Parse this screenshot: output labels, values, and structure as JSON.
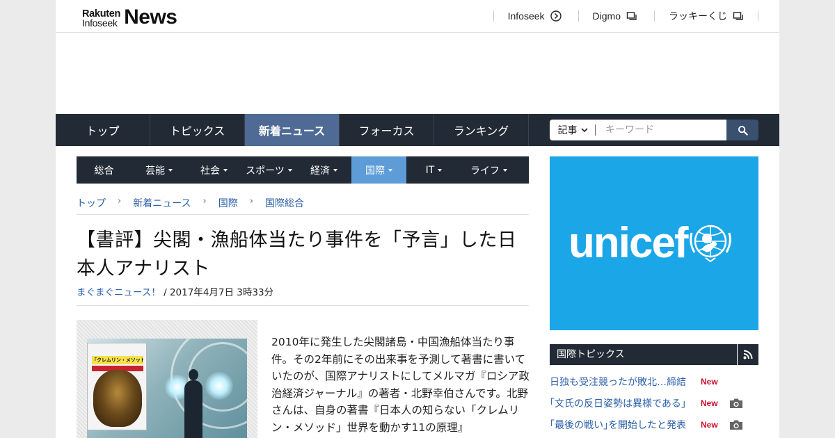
{
  "header": {
    "logo_top": "Rakuten",
    "logo_bottom": "Infoseek",
    "logo_main": "News",
    "links": [
      {
        "label": "Infoseek",
        "icon": "arrow-circle-icon"
      },
      {
        "label": "Digmo",
        "icon": "external-window-icon"
      },
      {
        "label": "ラッキーくじ",
        "icon": "external-window-icon"
      }
    ]
  },
  "main_nav": {
    "items": [
      "トップ",
      "トピックス",
      "新着ニュース",
      "フォーカス",
      "ランキング"
    ],
    "active": "新着ニュース"
  },
  "search": {
    "category": "記事",
    "placeholder": "キーワード"
  },
  "sub_nav": {
    "items": [
      "総合",
      "芸能",
      "社会",
      "スポーツ",
      "経済",
      "国際",
      "IT",
      "ライフ"
    ],
    "active": "国際"
  },
  "breadcrumb": [
    "トップ",
    "新着ニュース",
    "国際",
    "国際総合"
  ],
  "article": {
    "title": "【書評】尖閣・漁船体当たり事件を「予言」した日本人アナリスト",
    "source": "まぐまぐニュース！",
    "date": "/ 2017年4月7日 3時33分",
    "book_title": "「クレムリン・メソッド」",
    "body": "2010年に発生した尖閣諸島・中国漁船体当たり事件。その2年前にその出来事を予測して著書に書いていたのが、国際アナリストにしてメルマガ『ロシア政治経済ジャーナル』の著者・北野幸伯さんです。北野さんは、自身の著書『日本人の知らない「クレムリン・メソッド」世界を動かす11の原理』"
  },
  "sidebar": {
    "ad_text": "unicef",
    "topics_title": "国際トピックス",
    "topics": [
      {
        "label": "日独も受注競ったが敗北…締結",
        "badge": "New",
        "has_photo": false
      },
      {
        "label": "｢文氏の反日姿勢は異様である｣",
        "badge": "New",
        "has_photo": true
      },
      {
        "label": "｢最後の戦い｣を開始したと発表",
        "badge": "New",
        "has_photo": true
      }
    ]
  },
  "colors": {
    "nav_bg": "#222a35",
    "nav_active": "#4e6a95",
    "subnav_active": "#5d9cd7",
    "link": "#2a5ea8",
    "unicef_blue": "#1ba6e7",
    "new_badge": "#c8102e"
  }
}
